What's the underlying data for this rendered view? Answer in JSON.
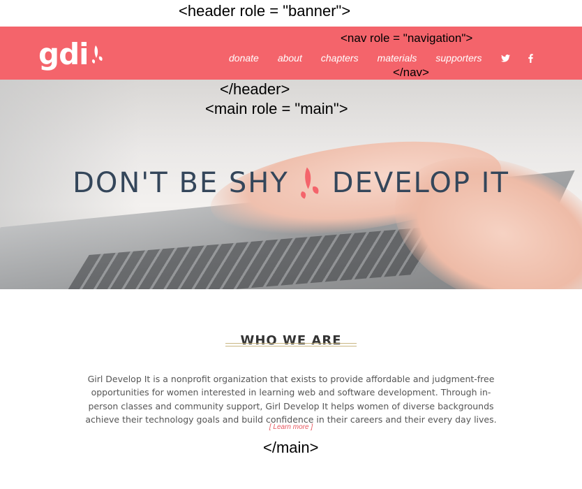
{
  "annotations": {
    "header_open": "<header role = \"banner\">",
    "nav_open": "<nav role = \"navigation\">",
    "nav_close": "</nav>",
    "header_close": "</header>",
    "main_open": "<main role = \"main\">",
    "main_close": "</main>"
  },
  "header": {
    "logo_text": "gdi",
    "logo_icon": "splash-icon",
    "nav": {
      "items": [
        "donate",
        "about",
        "chapters",
        "materials",
        "supporters"
      ],
      "social_icons": [
        "twitter-icon",
        "facebook-icon"
      ]
    }
  },
  "hero": {
    "title_left": "DON'T BE SHY",
    "title_right": "DEVELOP IT",
    "mark_icon": "splash-icon"
  },
  "who": {
    "title": "WHO WE ARE",
    "body": "Girl Develop It is a nonprofit organization that exists to provide affordable and judgment-free opportunities for women interested in learning web and software development. Through in-person classes and community support, Girl Develop It helps women of diverse backgrounds achieve their technology goals and build confidence in their careers and their every day lives.",
    "learn_more": "[ Learn more ]"
  },
  "colors": {
    "brand": "#f4646b",
    "hero_text": "#34465a",
    "accent_rule": "#c9b783",
    "link": "#e8575f"
  }
}
